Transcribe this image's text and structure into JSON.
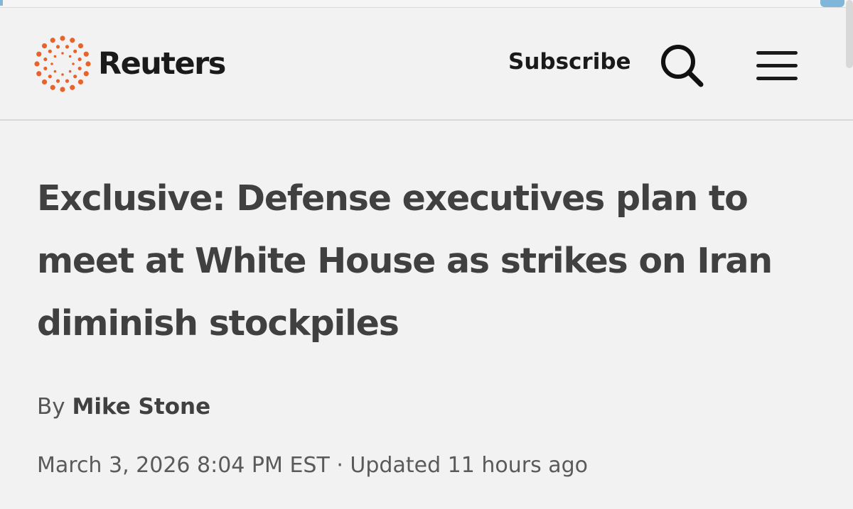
{
  "header": {
    "brand_name": "Reuters",
    "logo_icon": "reuters-dot-ring-logo",
    "subscribe_label": "Subscribe",
    "search_icon": "search-icon",
    "menu_icon": "hamburger-menu-icon"
  },
  "article": {
    "headline": "Exclusive: Defense executives plan to meet at White House as strikes on Iran diminish stockpiles",
    "byline_prefix": "By",
    "author": "Mike Stone",
    "published": "March 3, 2026 8:04 PM EST",
    "separator": "·",
    "updated": "Updated 11 hours ago"
  },
  "colors": {
    "brand_orange": "#e8632b",
    "background": "#f2f2f2",
    "text_dark": "#1a1a1a",
    "headline_gray": "#404040"
  }
}
